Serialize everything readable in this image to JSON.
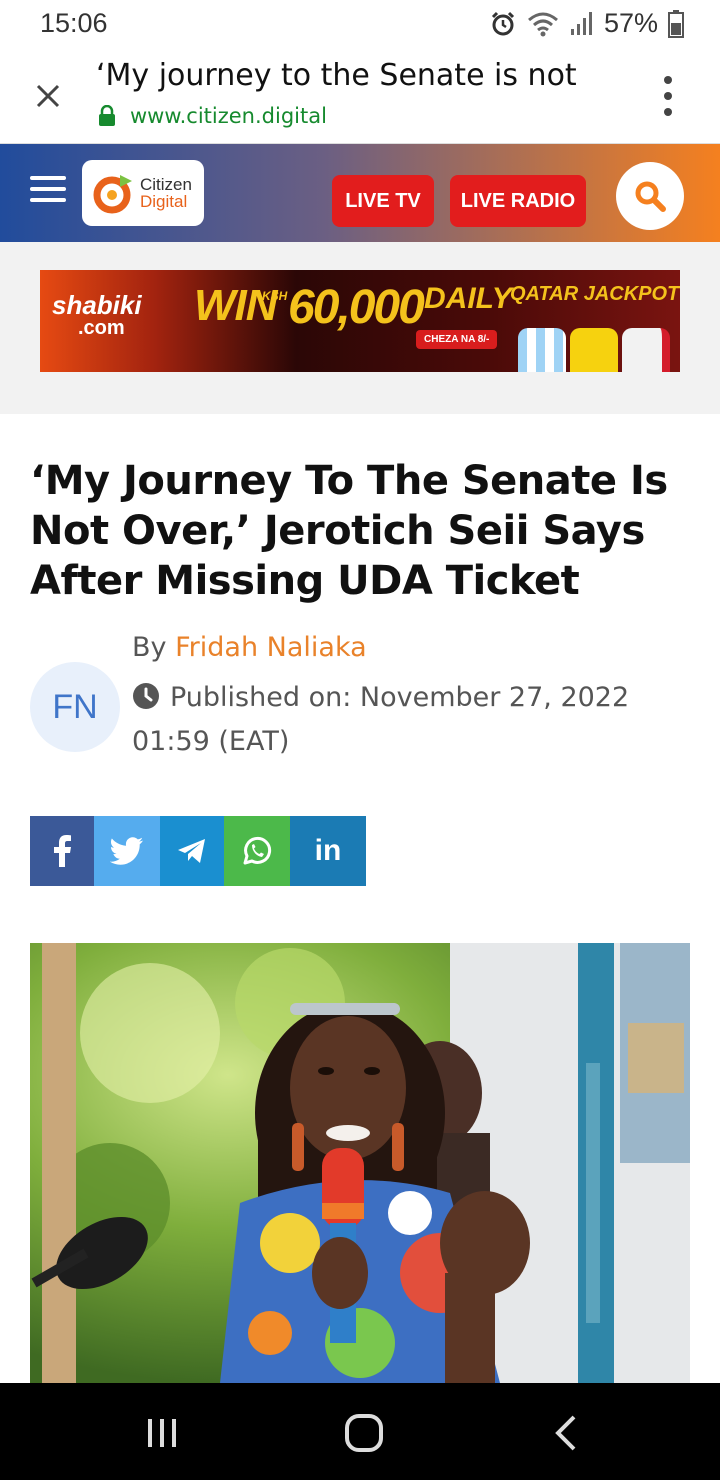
{
  "status_bar": {
    "time": "15:06",
    "battery": "57%"
  },
  "tab_bar": {
    "title": "‘My journey to the Senate is not",
    "url": "www.citizen.digital"
  },
  "site_header": {
    "logo_line1": "Citizen",
    "logo_line2": "Digital",
    "live_tv_label": "LIVE TV",
    "live_radio_label": "LIVE RADIO"
  },
  "ad": {
    "brand_line1": "shabiki",
    "brand_line2": ".com",
    "win": "WIN",
    "currency": "KSH",
    "amount": "60,000",
    "daily": "DAILY",
    "jackpot": "QATAR JACKPOT",
    "cta": "CHEZA NA 8/-"
  },
  "article": {
    "headline": "‘My Journey To The Senate Is Not Over,’ Jerotich Seii Says After Missing UDA Ticket",
    "avatar_initials": "FN",
    "by_prefix": "By",
    "author": "Fridah Naliaka",
    "published": "Published on: November 27, 2022 01:59 (EAT)"
  },
  "share": {
    "linkedin_label": "in"
  },
  "colors": {
    "accent_orange": "#f5801f",
    "live_red": "#e21d1d",
    "url_green": "#168a2e",
    "author_orange": "#e9822a"
  }
}
